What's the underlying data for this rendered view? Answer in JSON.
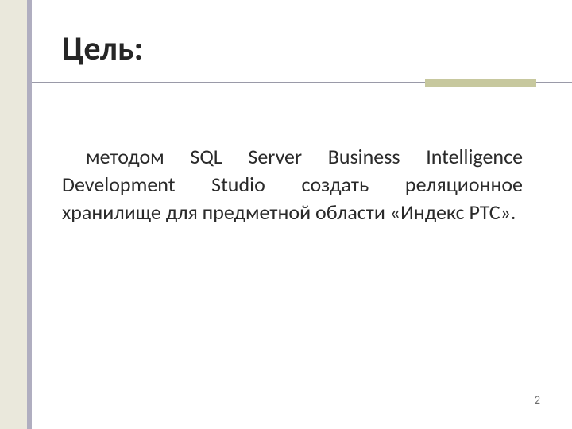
{
  "slide": {
    "title": "Цель:",
    "body": "методом SQL Server Business Intelligence Development Studio создать реляционное хранилище для предметной области «Индекс РТС».",
    "page_number": "2"
  }
}
